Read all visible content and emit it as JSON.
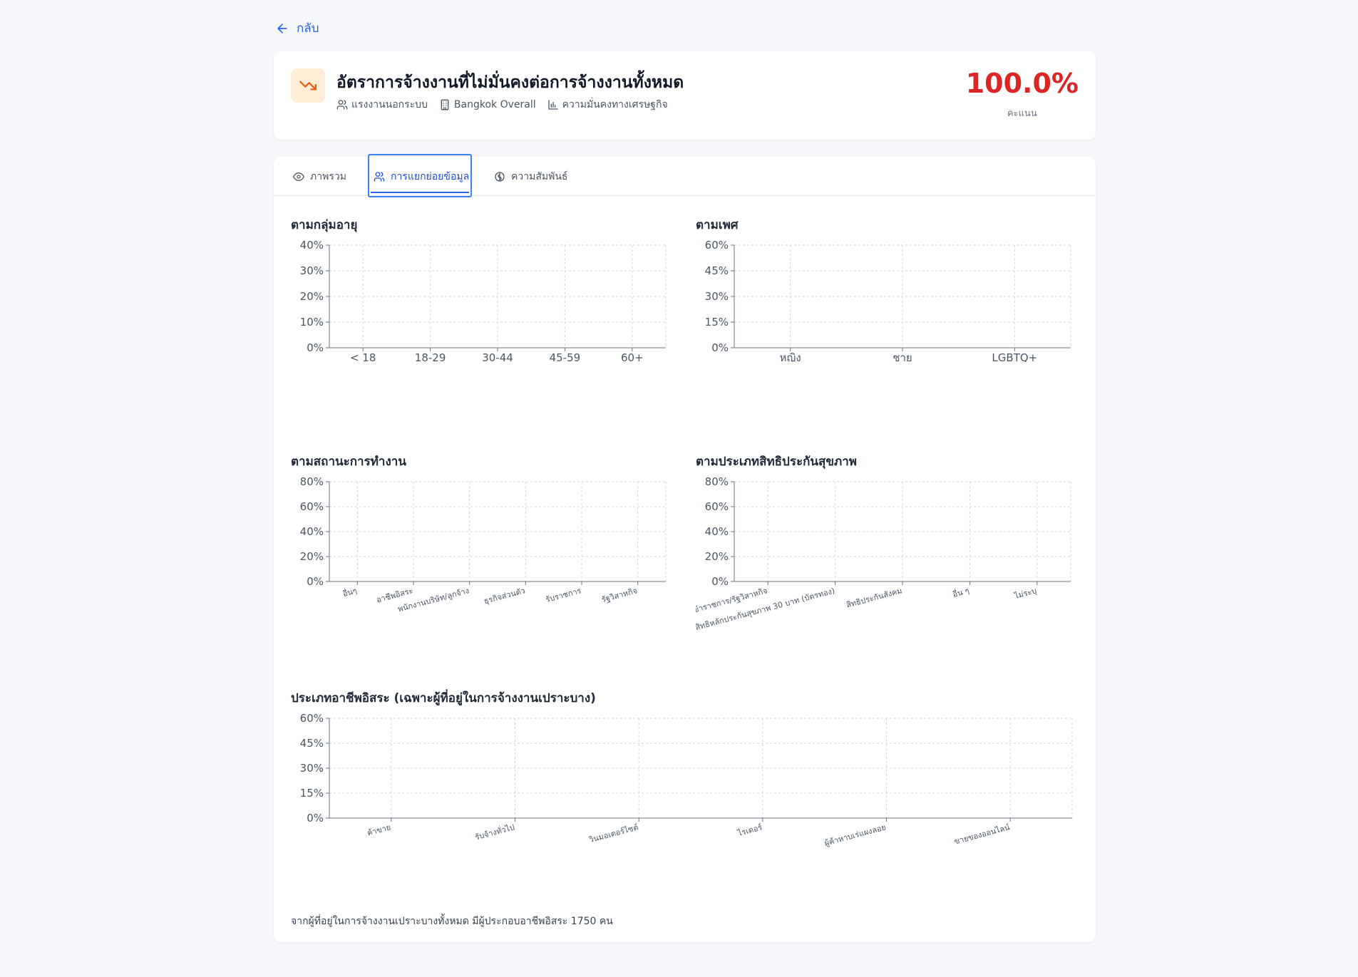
{
  "back_label": "กลับ",
  "header": {
    "title": "อัตราการจ้างงานที่ไม่มั่นคงต่อการจ้างงานทั้งหมด",
    "meta": [
      {
        "icon": "users-icon",
        "label": "แรงงานนอกระบบ"
      },
      {
        "icon": "building-icon",
        "label": "Bangkok Overall"
      },
      {
        "icon": "bar-chart-icon",
        "label": "ความมั่นคงทางเศรษฐกิจ"
      }
    ],
    "score_value": "100.0%",
    "score_label": "คะแนน",
    "score_color": "#dc2626",
    "icon_bg": "#ffedd5",
    "icon_color": "#ea580c"
  },
  "tabs": [
    {
      "icon": "eye-icon",
      "label": "ภาพรวม",
      "active": false
    },
    {
      "icon": "users-icon",
      "label": "การแยกย่อยข้อมูล",
      "active": true
    },
    {
      "icon": "brain-icon",
      "label": "ความสัมพันธ์",
      "active": false
    }
  ],
  "sections": {
    "age": "ตามกลุ่มอายุ",
    "gender": "ตามเพศ",
    "work_status": "ตามสถานะการทำงาน",
    "health": "ตามประเภทสิทธิประกันสุขภาพ",
    "freelance": "ประเภทอาชีพอิสระ (เฉพาะผู้ที่อยู่ในการจ้างงานเปราะบาง)"
  },
  "footer_note": "จากผู้ที่อยู่ในการจ้างงานเปราะบางทั้งหมด มีผู้ประกอบอาชีพอิสระ 1750 คน",
  "chart_data": [
    {
      "type": "bar",
      "title": "ตามกลุ่มอายุ",
      "categories": [
        "< 18",
        "18-29",
        "30-44",
        "45-59",
        "60+"
      ],
      "values": [
        0,
        0,
        0,
        0,
        0
      ],
      "yticks": [
        "0%",
        "10%",
        "20%",
        "30%",
        "40%"
      ],
      "ylim": [
        0,
        40
      ],
      "grid": true,
      "rotate_labels": false
    },
    {
      "type": "bar",
      "title": "ตามเพศ",
      "categories": [
        "หญิง",
        "ชาย",
        "LGBTQ+"
      ],
      "values": [
        0,
        0,
        0
      ],
      "yticks": [
        "0%",
        "15%",
        "30%",
        "45%",
        "60%"
      ],
      "ylim": [
        0,
        60
      ],
      "grid": true,
      "rotate_labels": false
    },
    {
      "type": "bar",
      "title": "ตามสถานะการทำงาน",
      "categories": [
        "อื่นๆ",
        "อาชีพอิสระ",
        "พนักงานบริษัท/ลูกจ้าง",
        "ธุรกิจส่วนตัว",
        "รับราชการ",
        "รัฐวิสาหกิจ"
      ],
      "values": [
        0,
        0,
        0,
        0,
        0,
        0
      ],
      "yticks": [
        "0%",
        "20%",
        "40%",
        "60%",
        "80%"
      ],
      "ylim": [
        0,
        80
      ],
      "grid": true,
      "rotate_labels": true
    },
    {
      "type": "bar",
      "title": "ตามประเภทสิทธิประกันสุขภาพ",
      "categories": [
        "สิทธิข้าราชการ/รัฐวิสาหกิจ",
        "สิทธิหลักประกันสุขภาพ 30 บาท (บัตรทอง)",
        "สิทธิประกันสังคม",
        "อื่น ๆ",
        "ไม่ระบุ"
      ],
      "values": [
        0,
        0,
        0,
        0,
        0
      ],
      "yticks": [
        "0%",
        "20%",
        "40%",
        "60%",
        "80%"
      ],
      "ylim": [
        0,
        80
      ],
      "grid": true,
      "rotate_labels": true
    },
    {
      "type": "bar",
      "title": "ประเภทอาชีพอิสระ (เฉพาะผู้ที่อยู่ในการจ้างงานเปราะบาง)",
      "categories": [
        "ค้าขาย",
        "รับจ้างทั่วไป",
        "วินมอเตอร์ไซต์",
        "ไรเดอร์",
        "ผู้ค้าหาบเร่แผงลอย",
        "ขายของออนไลน์"
      ],
      "values": [
        0,
        0,
        0,
        0,
        0,
        0
      ],
      "yticks": [
        "0%",
        "15%",
        "30%",
        "45%",
        "60%"
      ],
      "ylim": [
        0,
        60
      ],
      "grid": true,
      "rotate_labels": true
    }
  ]
}
